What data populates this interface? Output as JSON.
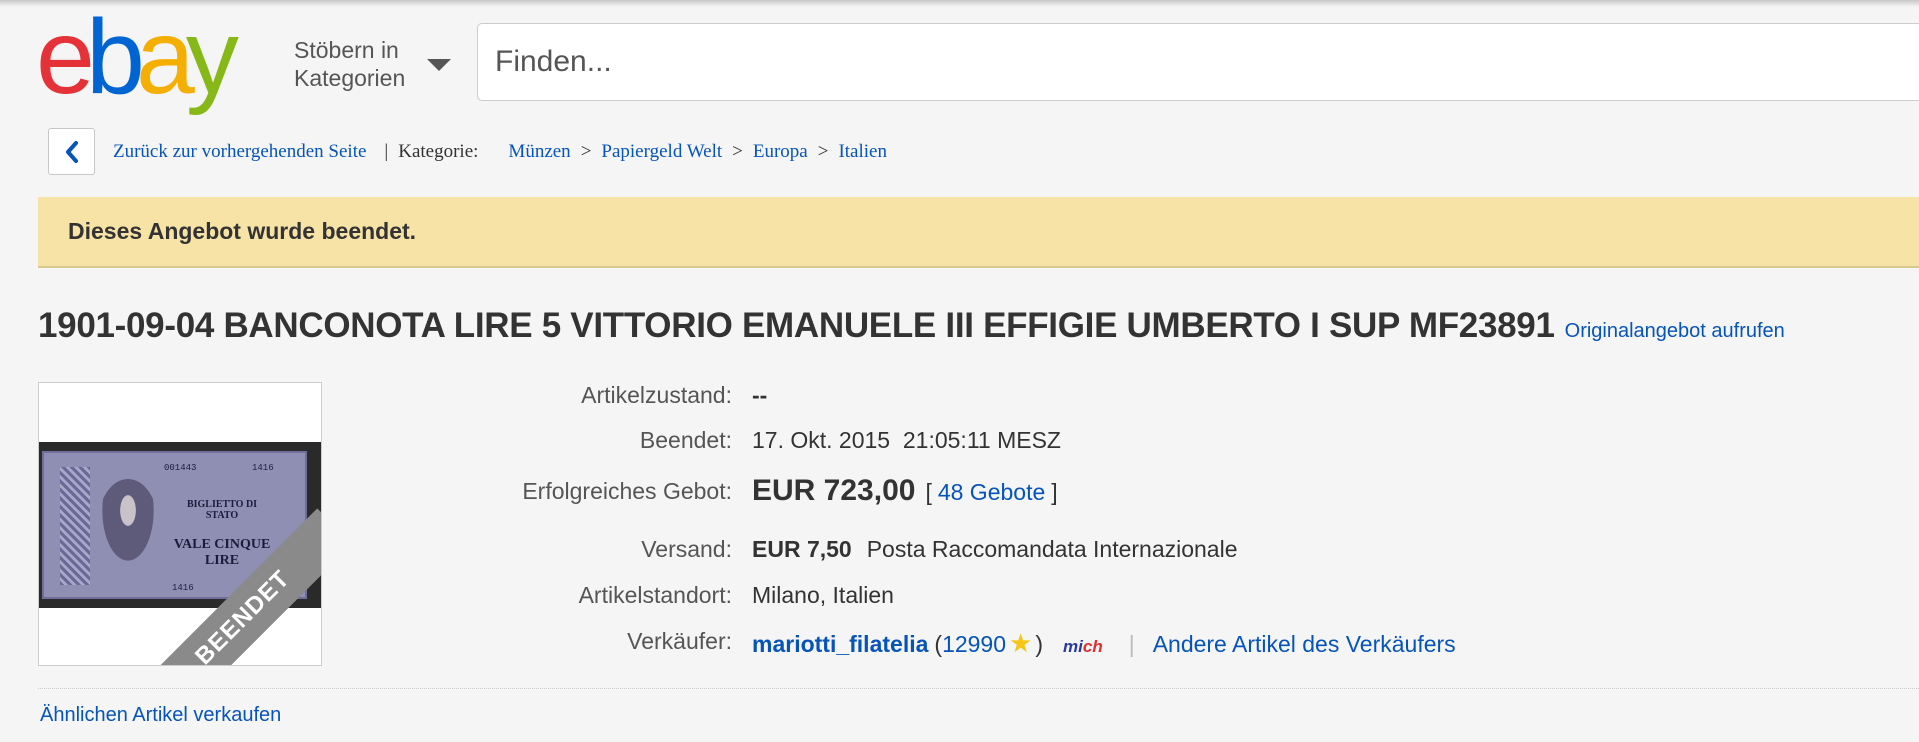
{
  "header": {
    "logo": {
      "e": "e",
      "b": "b",
      "a": "a",
      "y": "y"
    },
    "browse_label": "Stöbern in Kategorien",
    "search_placeholder": "Finden..."
  },
  "breadcrumb": {
    "back_label": "Zurück zur vorhergehenden Seite",
    "category_label": "Kategorie:",
    "items": [
      "Münzen",
      "Papiergeld Welt",
      "Europa",
      "Italien"
    ],
    "separator": ">"
  },
  "banner": {
    "message": "Dieses Angebot wurde beendet."
  },
  "listing": {
    "title": "1901-09-04 BANCONOTA LIRE 5 VITTORIO EMANUELE III EFFIGIE UMBERTO I SUP MF23891",
    "original_link": "Originalangebot aufrufen",
    "image": {
      "ribbon_text": "BEENDET",
      "note_header": "BIGLIETTO DI STATO",
      "note_value": "VALE CINQUE LIRE",
      "serial_a": "001443",
      "serial_b": "1416"
    }
  },
  "details": {
    "condition_label": "Artikelzustand:",
    "condition_value": "--",
    "ended_label": "Beendet:",
    "ended_date": "17. Okt. 2015",
    "ended_time": "21:05:11 MESZ",
    "bid_label": "Erfolgreiches Gebot:",
    "bid_price": "EUR 723,00",
    "bid_count": "48 Gebote",
    "bracket_open": "[",
    "bracket_close": "]",
    "shipping_label": "Versand:",
    "shipping_price": "EUR 7,50",
    "shipping_method": "Posta Raccomandata Internazionale",
    "location_label": "Artikelstandort:",
    "location_value": "Milano, Italien",
    "seller_label": "Verkäufer:",
    "seller_name": "mariotti_filatelia",
    "seller_score": "12990",
    "paren_open": "(",
    "paren_close": ")",
    "mich_part1": "mi",
    "mich_part2": "ch",
    "pipe": "|",
    "other_items": "Andere Artikel des Verkäufers"
  },
  "footer": {
    "sell_similar": "Ähnlichen Artikel verkaufen"
  },
  "colors": {
    "link_blue": "#0654ba",
    "banner_yellow": "#f7e3a6",
    "logo_red": "#e53238",
    "logo_blue": "#0064d2",
    "logo_yellow": "#f5af02",
    "logo_green": "#86b817"
  }
}
